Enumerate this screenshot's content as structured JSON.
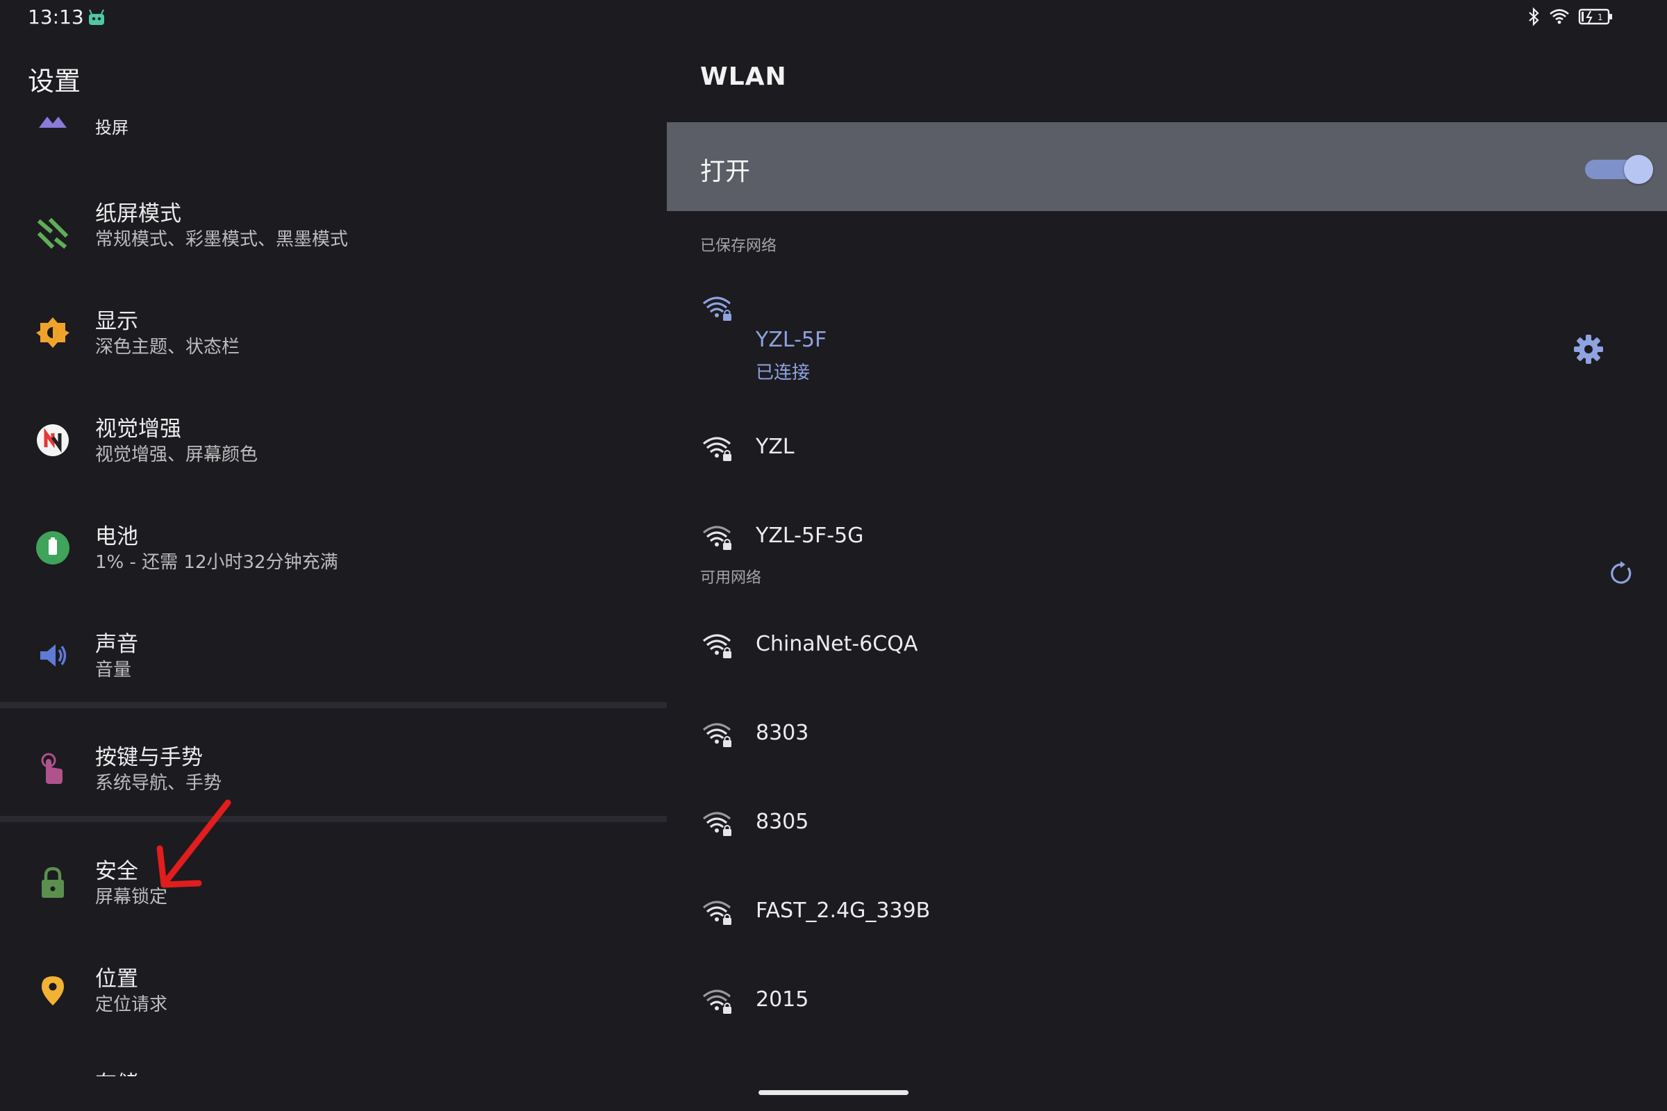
{
  "status_bar": {
    "time": "13:13"
  },
  "left_pane": {
    "title": "设置",
    "partial_top_item": "投屏",
    "items": [
      {
        "id": "paper-mode",
        "title": "纸屏模式",
        "subtitle": "常规模式、彩墨模式、黑墨模式",
        "icon": "paper-mode-icon",
        "color": "#5fae58"
      },
      {
        "id": "display",
        "title": "显示",
        "subtitle": "深色主题、状态栏",
        "icon": "brightness-icon",
        "color": "#f0a32a"
      },
      {
        "id": "visual-enhance",
        "title": "视觉增强",
        "subtitle": "视觉增强、屏幕颜色",
        "icon": "visual-enhance-icon",
        "color": "#e53935"
      },
      {
        "id": "battery",
        "title": "电池",
        "subtitle": "1% - 还需 12小时32分钟充满",
        "icon": "battery-icon",
        "color": "#3fa35b"
      },
      {
        "id": "sound",
        "title": "声音",
        "subtitle": "音量",
        "icon": "speaker-icon",
        "color": "#5f7bd6"
      },
      {
        "id": "buttons-gestures",
        "title": "按键与手势",
        "subtitle": "系统导航、手势",
        "icon": "gesture-icon",
        "color": "#b0528c"
      },
      {
        "id": "security",
        "title": "安全",
        "subtitle": "屏幕锁定",
        "icon": "lock-icon",
        "color": "#5b8f4e"
      },
      {
        "id": "location",
        "title": "位置",
        "subtitle": "定位请求",
        "icon": "location-pin-icon",
        "color": "#f2b233"
      }
    ],
    "partial_bottom_item": "存储"
  },
  "right_pane": {
    "title": "WLAN",
    "master_switch": {
      "label": "打开",
      "on": true
    },
    "saved_header": "已保存网络",
    "saved_networks": [
      {
        "name": "YZL-5F",
        "status": "已连接",
        "connected": true
      },
      {
        "name": "YZL",
        "status": "",
        "connected": false
      },
      {
        "name": "YZL-5F-5G",
        "status": "",
        "connected": false
      }
    ],
    "available_header": "可用网络",
    "available_networks": [
      {
        "name": "ChinaNet-6CQA"
      },
      {
        "name": "8303"
      },
      {
        "name": "8305"
      },
      {
        "name": "FAST_2.4G_339B"
      },
      {
        "name": "2015"
      }
    ]
  },
  "colors": {
    "background": "#1c1b20",
    "accent": "#8fa3e0",
    "master_bar": "#5b5e66",
    "annotation_arrow": "#e11d1d"
  }
}
